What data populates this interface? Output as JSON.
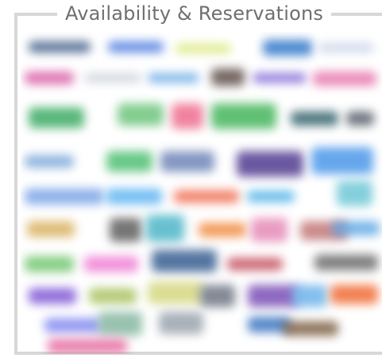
{
  "section_title": "Availability & Reservations",
  "logos": [
    {
      "name": "logo-tile",
      "color": "#3d5b86"
    },
    {
      "name": "logo-tile",
      "color": "#4c7be0"
    },
    {
      "name": "logo-tile",
      "color": "#d9e779"
    },
    {
      "name": "logo-tile",
      "color": "#2f76c9"
    },
    {
      "name": "logo-tile",
      "color": "#c9d3e8"
    },
    {
      "name": "logo-tile",
      "color": "#d85da6"
    },
    {
      "name": "logo-tile",
      "color": "#ccd2db"
    },
    {
      "name": "logo-tile",
      "color": "#67a8e6"
    },
    {
      "name": "logo-tile",
      "color": "#5f4f48"
    },
    {
      "name": "logo-tile",
      "color": "#7c63d6"
    },
    {
      "name": "logo-tile",
      "color": "#e777ae"
    },
    {
      "name": "logo-tile",
      "color": "#3cab64"
    },
    {
      "name": "logo-tile",
      "color": "#6cc47c"
    },
    {
      "name": "logo-tile",
      "color": "#ef6d8d"
    },
    {
      "name": "logo-tile",
      "color": "#44b55b"
    },
    {
      "name": "logo-tile",
      "color": "#2f5f68"
    },
    {
      "name": "logo-tile",
      "color": "#565d69"
    },
    {
      "name": "logo-tile",
      "color": "#7aa7d9"
    },
    {
      "name": "logo-tile",
      "color": "#4fbf72"
    },
    {
      "name": "logo-tile",
      "color": "#6e85b8"
    },
    {
      "name": "logo-tile",
      "color": "#4f3a8f"
    },
    {
      "name": "logo-tile",
      "color": "#4b97ea"
    },
    {
      "name": "logo-tile",
      "color": "#7aa4e7"
    },
    {
      "name": "logo-tile",
      "color": "#5fb4f2"
    },
    {
      "name": "logo-tile",
      "color": "#f06d50"
    },
    {
      "name": "logo-tile",
      "color": "#4ab0e6"
    },
    {
      "name": "logo-tile",
      "color": "#6ec7d6"
    },
    {
      "name": "logo-tile",
      "color": "#d8b15f"
    },
    {
      "name": "logo-tile",
      "color": "#5d5d5d"
    },
    {
      "name": "logo-tile",
      "color": "#4db5c7"
    },
    {
      "name": "logo-tile",
      "color": "#f18a3f"
    },
    {
      "name": "logo-tile",
      "color": "#e58ab7"
    },
    {
      "name": "logo-tile",
      "color": "#c27575"
    },
    {
      "name": "logo-tile",
      "color": "#5ea8e5"
    },
    {
      "name": "logo-tile",
      "color": "#72c66e"
    },
    {
      "name": "logo-tile",
      "color": "#ef7fd4"
    },
    {
      "name": "logo-tile",
      "color": "#375d91"
    },
    {
      "name": "logo-tile",
      "color": "#c54d5e"
    },
    {
      "name": "logo-tile",
      "color": "#6a6a6a"
    },
    {
      "name": "logo-tile",
      "color": "#7f57d6"
    },
    {
      "name": "logo-tile",
      "color": "#a7c35f"
    },
    {
      "name": "logo-tile",
      "color": "#d4d77f"
    },
    {
      "name": "logo-tile",
      "color": "#6e7684"
    },
    {
      "name": "logo-tile",
      "color": "#7a4fb5"
    },
    {
      "name": "logo-tile",
      "color": "#6db4ea"
    },
    {
      "name": "logo-tile",
      "color": "#f06b33"
    },
    {
      "name": "logo-tile",
      "color": "#7f86f0"
    },
    {
      "name": "logo-tile",
      "color": "#86b7a1"
    },
    {
      "name": "logo-tile",
      "color": "#9aa3ad"
    },
    {
      "name": "logo-tile",
      "color": "#3a74c0"
    },
    {
      "name": "logo-tile",
      "color": "#7a5c3f"
    },
    {
      "name": "logo-tile",
      "color": "#e66aa0"
    }
  ]
}
